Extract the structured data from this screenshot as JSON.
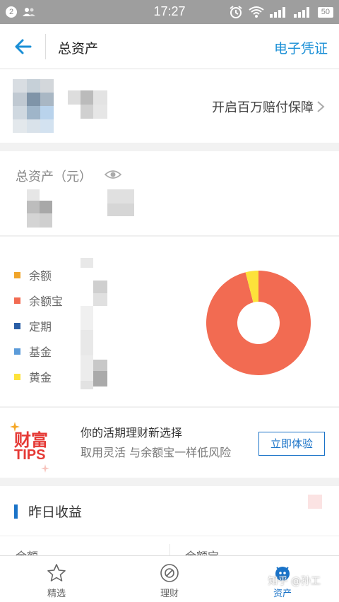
{
  "status_bar": {
    "notification_count": "2",
    "time": "17:27",
    "battery": "50"
  },
  "nav": {
    "title": "总资产",
    "right_action": "电子凭证"
  },
  "account": {
    "guarantee_link": "开启百万赔付保障"
  },
  "total_assets": {
    "label": "总资产（元）"
  },
  "distribution": {
    "legend": [
      {
        "label": "余额",
        "color": "#f0a52b"
      },
      {
        "label": "余额宝",
        "color": "#f26b52"
      },
      {
        "label": "定期",
        "color": "#2a5ea6"
      },
      {
        "label": "基金",
        "color": "#5b9bd9"
      },
      {
        "label": "黄金",
        "color": "#fde23a"
      }
    ],
    "chart_data": {
      "type": "pie",
      "categories": [
        "余额宝",
        "黄金"
      ],
      "values": [
        96,
        4
      ],
      "colors": [
        "#f26b52",
        "#fde23a"
      ]
    }
  },
  "tips": {
    "logo_line1": "财富",
    "logo_line2": "TIPS",
    "title": "你的活期理财新选择",
    "subtitle": "取用灵活 与余额宝一样低风险",
    "button": "立即体验"
  },
  "yesterday": {
    "title": "昨日收益",
    "col1": "余额",
    "col2": "余额宝"
  },
  "tabbar": {
    "tabs": [
      {
        "label": "精选",
        "icon": "star-icon"
      },
      {
        "label": "理财",
        "icon": "finance-icon"
      },
      {
        "label": "资产",
        "icon": "assets-icon"
      }
    ]
  },
  "watermark": "知乎 @孙工"
}
